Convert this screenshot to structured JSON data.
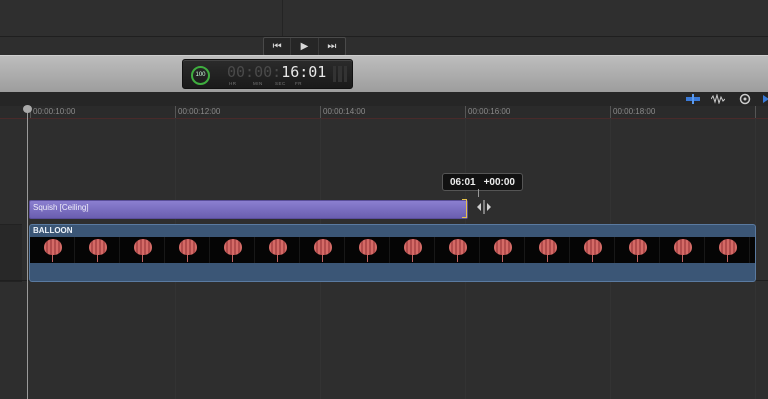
{
  "transport": {
    "prev_icon": "⏮",
    "play_icon": "▶",
    "next_icon": "⏭"
  },
  "timecode": {
    "percent": "100",
    "dim_digits": "00:00:",
    "bright_digits": "16:01",
    "labels": [
      "HR",
      "MIN",
      "SEC",
      "FR"
    ]
  },
  "ruler": {
    "ticks": [
      "00:00:10:00",
      "00:00:12:00",
      "00:00:14:00",
      "00:00:16:00",
      "00:00:18:00"
    ]
  },
  "tools": {
    "icons": [
      "clip-appearance-icon",
      "audio-waveform-icon",
      "skimming-icon",
      "snapping-icon"
    ]
  },
  "title_clip": {
    "label": "Squish [Ceiling]",
    "color": "#7b6fc4"
  },
  "tooltip": {
    "position": "06:01",
    "delta": "+00:00"
  },
  "video_clip": {
    "label": "BALLOON",
    "color": "#3b5676",
    "frame_count": 16
  }
}
